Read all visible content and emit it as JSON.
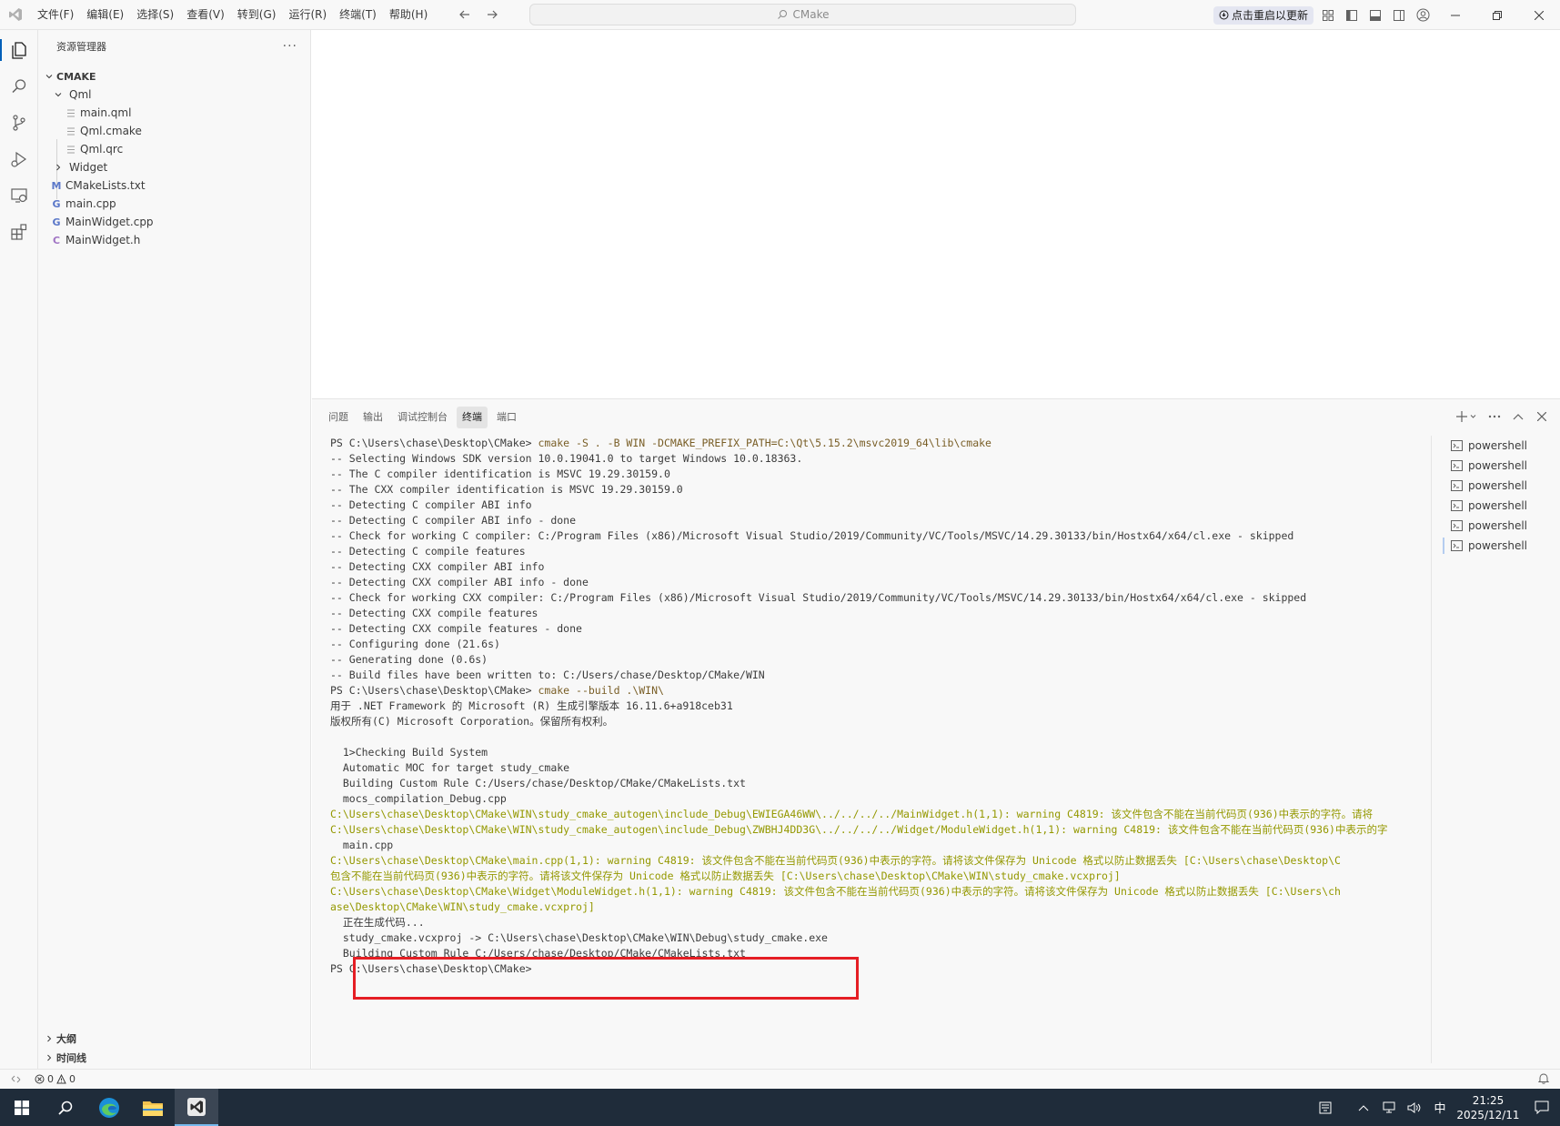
{
  "titlebar": {
    "menus": [
      "文件(F)",
      "编辑(E)",
      "选择(S)",
      "查看(V)",
      "转到(G)",
      "运行(R)",
      "终端(T)",
      "帮助(H)"
    ],
    "search": "CMake",
    "update_label": "点击重启以更新"
  },
  "sidebar": {
    "title": "资源管理器",
    "more": "···",
    "root": "CMAKE",
    "items": [
      {
        "label": "Qml"
      },
      {
        "label": "main.qml"
      },
      {
        "label": "Qml.cmake"
      },
      {
        "label": "Qml.qrc"
      },
      {
        "label": "Widget"
      },
      {
        "label": "CMakeLists.txt",
        "icon_text": "M"
      },
      {
        "label": "main.cpp",
        "icon_text": "G"
      },
      {
        "label": "MainWidget.cpp",
        "icon_text": "G"
      },
      {
        "label": "MainWidget.h",
        "icon_text": "C"
      }
    ],
    "outline": "大纲",
    "timeline": "时间线"
  },
  "panel": {
    "tabs": [
      "问题",
      "输出",
      "调试控制台",
      "终端",
      "端口"
    ],
    "active_tab": "终端",
    "terminal_lines": [
      {
        "prompt": "PS C:\\Users\\chase\\Desktop\\CMake> ",
        "cmd": "cmake -S . -B WIN -DCMAKE_PREFIX_PATH=C:\\Qt\\5.15.2\\msvc2019_64\\lib\\cmake",
        "type": "normal"
      },
      {
        "text": "-- Selecting Windows SDK version 10.0.19041.0 to target Windows 10.0.18363.",
        "type": "normal"
      },
      {
        "text": "-- The C compiler identification is MSVC 19.29.30159.0",
        "type": "normal"
      },
      {
        "text": "-- The CXX compiler identification is MSVC 19.29.30159.0",
        "type": "normal"
      },
      {
        "text": "-- Detecting C compiler ABI info",
        "type": "normal"
      },
      {
        "text": "-- Detecting C compiler ABI info - done",
        "type": "normal"
      },
      {
        "text": "-- Check for working C compiler: C:/Program Files (x86)/Microsoft Visual Studio/2019/Community/VC/Tools/MSVC/14.29.30133/bin/Hostx64/x64/cl.exe - skipped",
        "type": "normal"
      },
      {
        "text": "-- Detecting C compile features",
        "type": "normal"
      },
      {
        "text": "-- Detecting CXX compiler ABI info",
        "type": "normal"
      },
      {
        "text": "-- Detecting CXX compiler ABI info - done",
        "type": "normal"
      },
      {
        "text": "-- Check for working CXX compiler: C:/Program Files (x86)/Microsoft Visual Studio/2019/Community/VC/Tools/MSVC/14.29.30133/bin/Hostx64/x64/cl.exe - skipped",
        "type": "normal"
      },
      {
        "text": "-- Detecting CXX compile features",
        "type": "normal"
      },
      {
        "text": "-- Detecting CXX compile features - done",
        "type": "normal"
      },
      {
        "text": "-- Configuring done (21.6s)",
        "type": "normal"
      },
      {
        "text": "-- Generating done (0.6s)",
        "type": "normal"
      },
      {
        "text": "-- Build files have been written to: C:/Users/chase/Desktop/CMake/WIN",
        "type": "normal"
      },
      {
        "prompt": "PS C:\\Users\\chase\\Desktop\\CMake> ",
        "cmd": "cmake --build .\\WIN\\",
        "type": "normal"
      },
      {
        "text": "用于 .NET Framework 的 Microsoft (R) 生成引擎版本 16.11.6+a918ceb31",
        "type": "normal"
      },
      {
        "text": "版权所有(C) Microsoft Corporation。保留所有权利。",
        "type": "normal"
      },
      {
        "text": "",
        "type": "normal"
      },
      {
        "text": "  1>Checking Build System",
        "type": "normal"
      },
      {
        "text": "  Automatic MOC for target study_cmake",
        "type": "normal"
      },
      {
        "text": "  Building Custom Rule C:/Users/chase/Desktop/CMake/CMakeLists.txt",
        "type": "normal"
      },
      {
        "text": "  mocs_compilation_Debug.cpp",
        "type": "normal"
      },
      {
        "text": "C:\\Users\\chase\\Desktop\\CMake\\WIN\\study_cmake_autogen\\include_Debug\\EWIEGA46WW\\../../../../MainWidget.h(1,1): warning C4819: 该文件包含不能在当前代码页(936)中表示的字符。请将",
        "type": "warn"
      },
      {
        "text": "C:\\Users\\chase\\Desktop\\CMake\\WIN\\study_cmake_autogen\\include_Debug\\ZWBHJ4DD3G\\../../../../Widget/ModuleWidget.h(1,1): warning C4819: 该文件包含不能在当前代码页(936)中表示的字",
        "type": "warn"
      },
      {
        "text": "  main.cpp",
        "type": "normal"
      },
      {
        "text": "C:\\Users\\chase\\Desktop\\CMake\\main.cpp(1,1): warning C4819: 该文件包含不能在当前代码页(936)中表示的字符。请将该文件保存为 Unicode 格式以防止数据丢失 [C:\\Users\\chase\\Desktop\\C",
        "type": "warn"
      },
      {
        "text": "包含不能在当前代码页(936)中表示的字符。请将该文件保存为 Unicode 格式以防止数据丢失 [C:\\Users\\chase\\Desktop\\CMake\\WIN\\study_cmake.vcxproj]",
        "type": "warn"
      },
      {
        "text": "C:\\Users\\chase\\Desktop\\CMake\\Widget\\ModuleWidget.h(1,1): warning C4819: 该文件包含不能在当前代码页(936)中表示的字符。请将该文件保存为 Unicode 格式以防止数据丢失 [C:\\Users\\ch",
        "type": "warn"
      },
      {
        "text": "ase\\Desktop\\CMake\\WIN\\study_cmake.vcxproj]",
        "type": "warn"
      },
      {
        "text": "  正在生成代码...",
        "type": "normal"
      },
      {
        "text": "  study_cmake.vcxproj -> C:\\Users\\chase\\Desktop\\CMake\\WIN\\Debug\\study_cmake.exe",
        "type": "normal"
      },
      {
        "text": "  Building Custom Rule C:/Users/chase/Desktop/CMake/CMakeLists.txt",
        "type": "normal"
      },
      {
        "prompt": "PS C:\\Users\\chase\\Desktop\\CMake> ",
        "cmd": "",
        "type": "normal"
      }
    ],
    "terminals": [
      "powershell",
      "powershell",
      "powershell",
      "powershell",
      "powershell",
      "powershell"
    ]
  },
  "statusbar": {
    "errors": "0",
    "warnings": "0"
  },
  "taskbar": {
    "ime": "中",
    "time": "21:25",
    "date": "2025/12/11"
  },
  "colors": {
    "accent": "#005fb8",
    "warning_text": "#949800",
    "highlight_box": "#e51e24",
    "taskbar": "#1f2c3a"
  }
}
